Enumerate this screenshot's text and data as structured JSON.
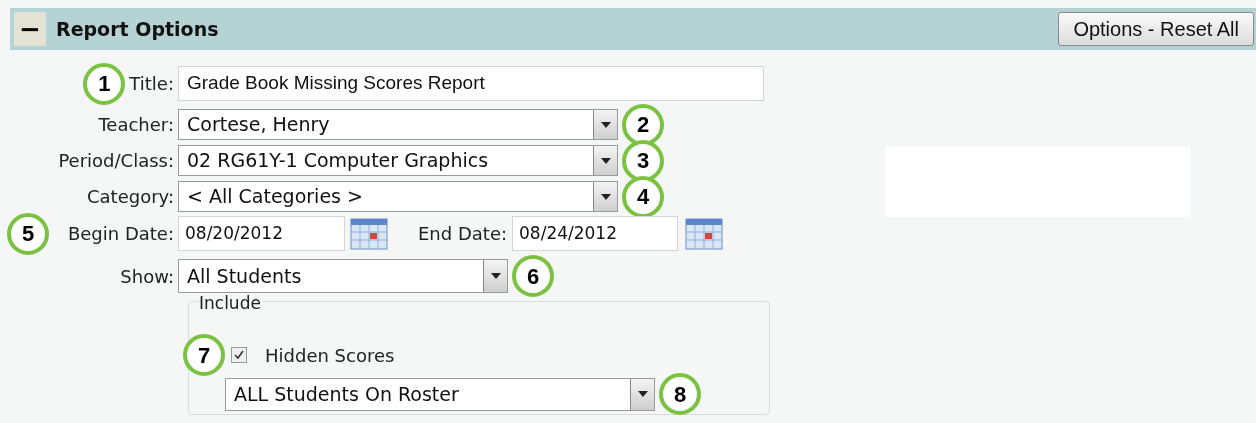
{
  "header": {
    "collapse_symbol": "−",
    "title": "Report Options",
    "reset_button": "Options - Reset All"
  },
  "rows": [
    {
      "kind": "text",
      "label": "Title:",
      "value": "Grade Book Missing Scores Report",
      "callout": "1"
    },
    {
      "kind": "select",
      "label": "Teacher:",
      "value": "Cortese, Henry",
      "callout": "2"
    },
    {
      "kind": "select",
      "label": "Period/Class:",
      "value": "02 RG61Y-1 Computer Graphics",
      "callout": "3"
    },
    {
      "kind": "select",
      "label": "Category:",
      "value": "< All Categories >",
      "callout": "4"
    },
    {
      "kind": "dates",
      "label": "Begin Date:",
      "value": "08/20/2012",
      "end_label": "End Date:",
      "end_value": "08/24/2012",
      "callout": "5"
    },
    {
      "kind": "short_select",
      "label": "Show:",
      "value": "All Students",
      "callout": "6"
    }
  ],
  "include": {
    "legend": "Include",
    "checkbox": {
      "label": "Hidden Scores",
      "checked": true,
      "callout": "7"
    },
    "select": {
      "value": "ALL Students On Roster",
      "callout": "8"
    }
  }
}
